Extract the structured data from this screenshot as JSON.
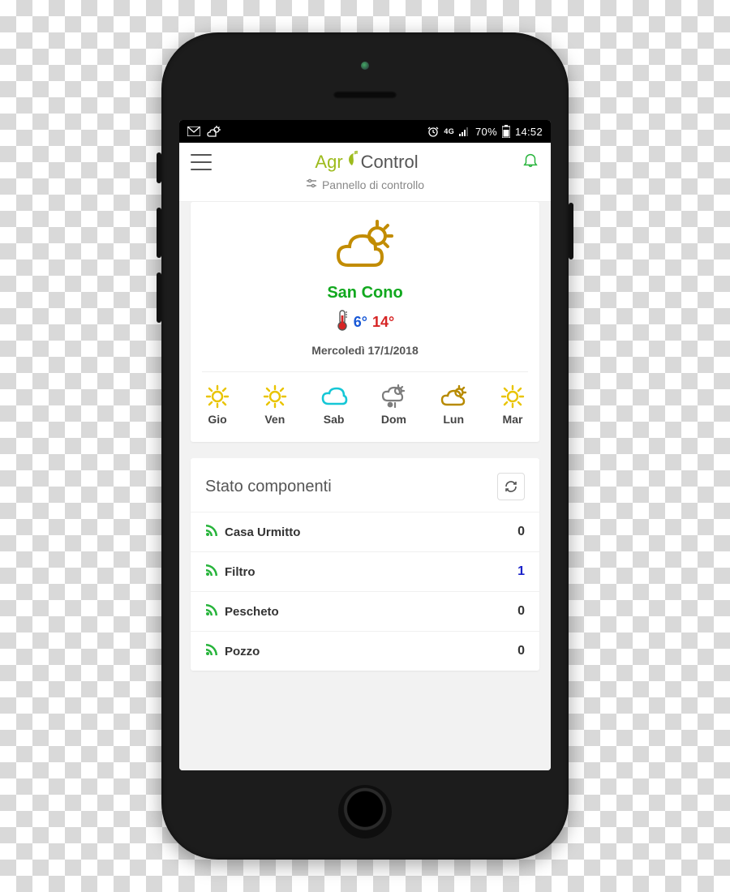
{
  "status_bar": {
    "battery_text": "70%",
    "time": "14:52",
    "network_label": "4G"
  },
  "app": {
    "logo_part1": "Agr",
    "logo_part2": "Control",
    "subtitle": "Pannello di controllo"
  },
  "weather": {
    "city": "San Cono",
    "low": "6°",
    "high": "14°",
    "date": "Mercoledì 17/1/2018",
    "forecast": [
      {
        "day": "Gio",
        "icon": "sun"
      },
      {
        "day": "Ven",
        "icon": "sun"
      },
      {
        "day": "Sab",
        "icon": "cloud"
      },
      {
        "day": "Dom",
        "icon": "rain"
      },
      {
        "day": "Lun",
        "icon": "partly"
      },
      {
        "day": "Mar",
        "icon": "sun"
      }
    ]
  },
  "components": {
    "title": "Stato componenti",
    "items": [
      {
        "name": "Casa Urmitto",
        "value": "0",
        "highlight": false
      },
      {
        "name": "Filtro",
        "value": "1",
        "highlight": true
      },
      {
        "name": "Pescheto",
        "value": "0",
        "highlight": false
      },
      {
        "name": "Pozzo",
        "value": "0",
        "highlight": false
      }
    ]
  }
}
